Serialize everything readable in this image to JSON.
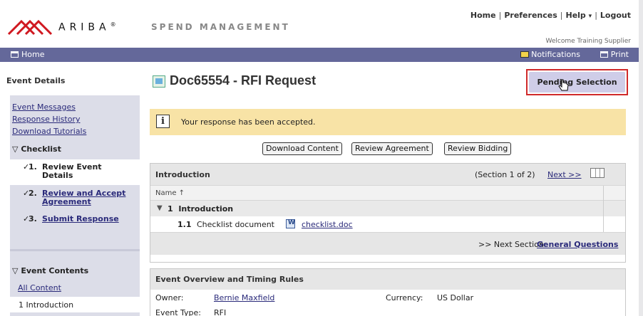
{
  "header": {
    "brand": "ARIBA",
    "registered": "®",
    "product": "SPEND MANAGEMENT",
    "top_links": {
      "home": "Home",
      "preferences": "Preferences",
      "help": "Help",
      "help_arrow": "▾",
      "logout": "Logout"
    },
    "welcome": "Welcome Training Supplier"
  },
  "navbar": {
    "home": "Home",
    "notifications": "Notifications",
    "print": "Print"
  },
  "sidebar": {
    "title": "Event Details",
    "links": [
      "Event Messages",
      "Response History",
      "Download Tutorials"
    ],
    "checklist_heading": "Checklist",
    "steps": [
      {
        "num": "1.",
        "label_line1": "Review Event",
        "label_line2": "Details",
        "done": "✓"
      },
      {
        "num": "2.",
        "label_line1": "Review and Accept",
        "label_line2": "Agreement",
        "done": "✓"
      },
      {
        "num": "3.",
        "label_line1": "Submit Response",
        "label_line2": "",
        "done": "✓"
      }
    ],
    "contents_heading": "Event Contents",
    "all_content": "All Content",
    "contents_items": [
      "1  Introduction"
    ]
  },
  "main": {
    "doc_title": "Doc65554 - RFI Request",
    "status_button": "Pending Selection",
    "message": "Your response has been accepted.",
    "buttons": {
      "download": "Download Content",
      "agreement": "Review Agreement",
      "bidding": "Review Bidding"
    },
    "introduction": {
      "title": "Introduction",
      "section_info": "(Section 1 of 2)",
      "next": "Next >>",
      "column_name": "Name ↑",
      "rows": [
        {
          "num": "1",
          "label": "Introduction"
        },
        {
          "num": "1.1",
          "label": "Checklist document",
          "link": "checklist.doc"
        }
      ],
      "next_section_label": ">> Next Section:",
      "next_section_link": "General Questions"
    },
    "overview": {
      "title": "Event Overview and Timing Rules",
      "owner_label": "Owner:",
      "owner_value": "Bernie Maxfield",
      "currency_label": "Currency:",
      "currency_value": "US Dollar",
      "event_type_label": "Event Type:",
      "event_type_value": "RFI"
    }
  }
}
